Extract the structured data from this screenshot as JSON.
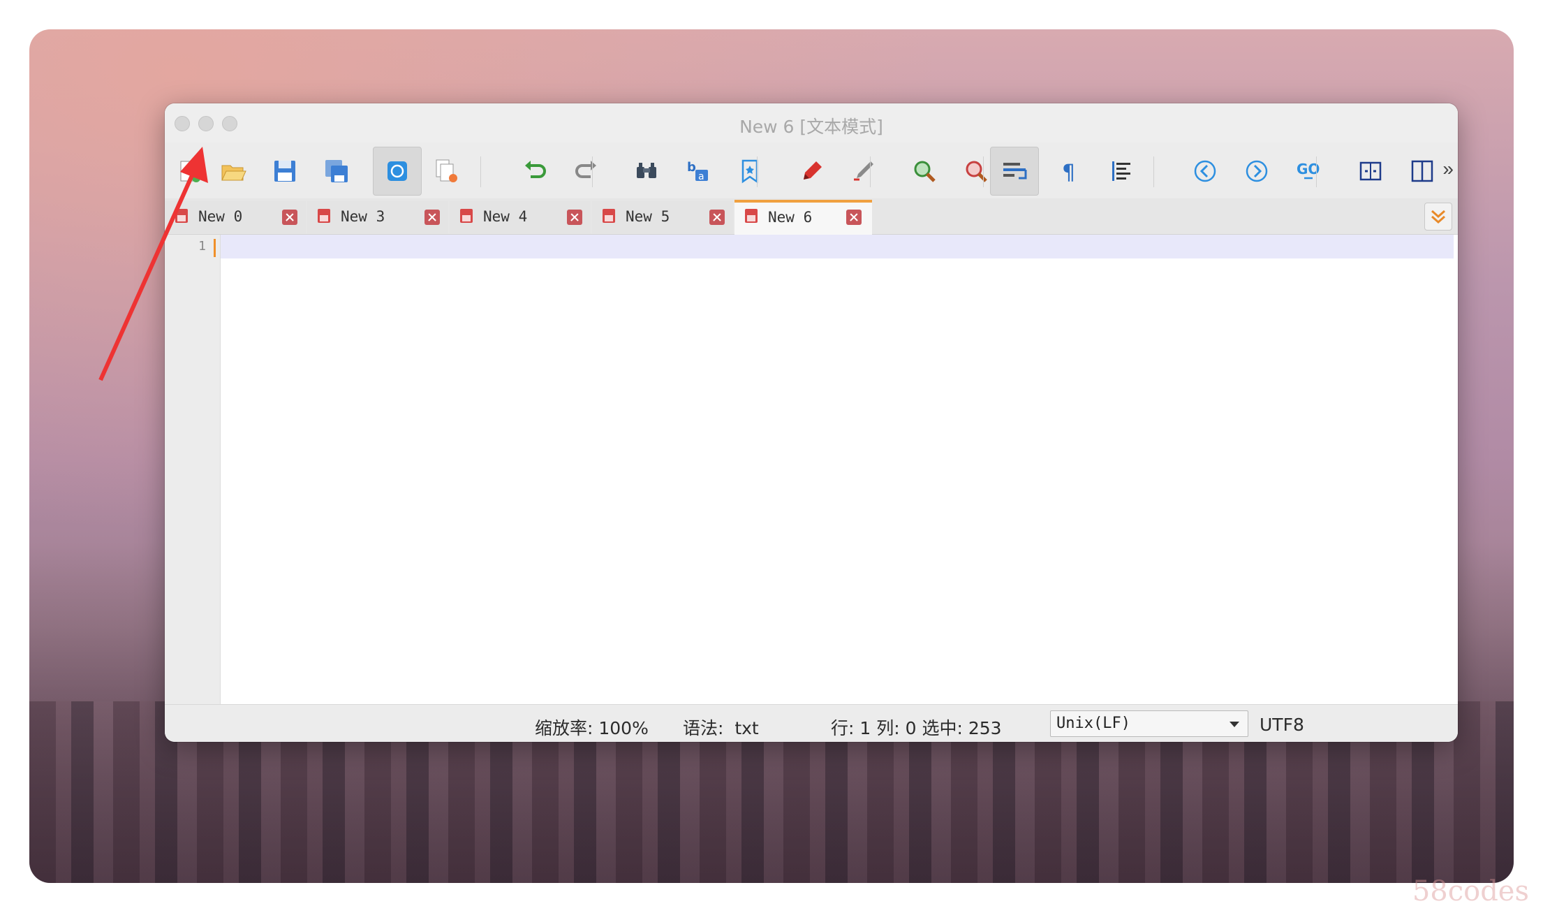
{
  "window": {
    "title": "New 6 [文本模式]"
  },
  "toolbar": {
    "buttons": [
      {
        "name": "new-file-icon"
      },
      {
        "name": "open-file-icon"
      },
      {
        "name": "save-icon"
      },
      {
        "name": "save-all-icon"
      },
      {
        "name": "compare-icon",
        "active": true
      },
      {
        "name": "close-file-icon"
      },
      {
        "name": "undo-icon"
      },
      {
        "name": "redo-icon"
      },
      {
        "name": "find-icon"
      },
      {
        "name": "replace-icon"
      },
      {
        "name": "bookmark-icon"
      },
      {
        "name": "marker-icon"
      },
      {
        "name": "clear-mark-icon"
      },
      {
        "name": "zoom-in-icon"
      },
      {
        "name": "zoom-out-icon"
      },
      {
        "name": "word-wrap-icon",
        "active": true
      },
      {
        "name": "show-symbols-icon"
      },
      {
        "name": "indent-guide-icon"
      },
      {
        "name": "previous-icon"
      },
      {
        "name": "next-icon"
      },
      {
        "name": "goto-icon"
      },
      {
        "name": "fullscreen-icon"
      },
      {
        "name": "split-view-icon"
      }
    ],
    "more_label": "»"
  },
  "tabs": [
    {
      "label": "New 0",
      "active": false
    },
    {
      "label": "New 3",
      "active": false
    },
    {
      "label": "New 4",
      "active": false
    },
    {
      "label": "New 5",
      "active": false
    },
    {
      "label": "New 6",
      "active": true
    }
  ],
  "editor": {
    "line_number": "1"
  },
  "status": {
    "zoom": "缩放率: 100%",
    "syntax": "语法:  txt",
    "position": "行: 1 列: 0 选中: 253",
    "eol": "Unix(LF)",
    "encoding": "UTF8"
  },
  "watermark": "58codes",
  "colors": {
    "accent_tab": "#f0a040",
    "close_button": "#c8555a",
    "annotation_arrow": "#ee3333"
  }
}
